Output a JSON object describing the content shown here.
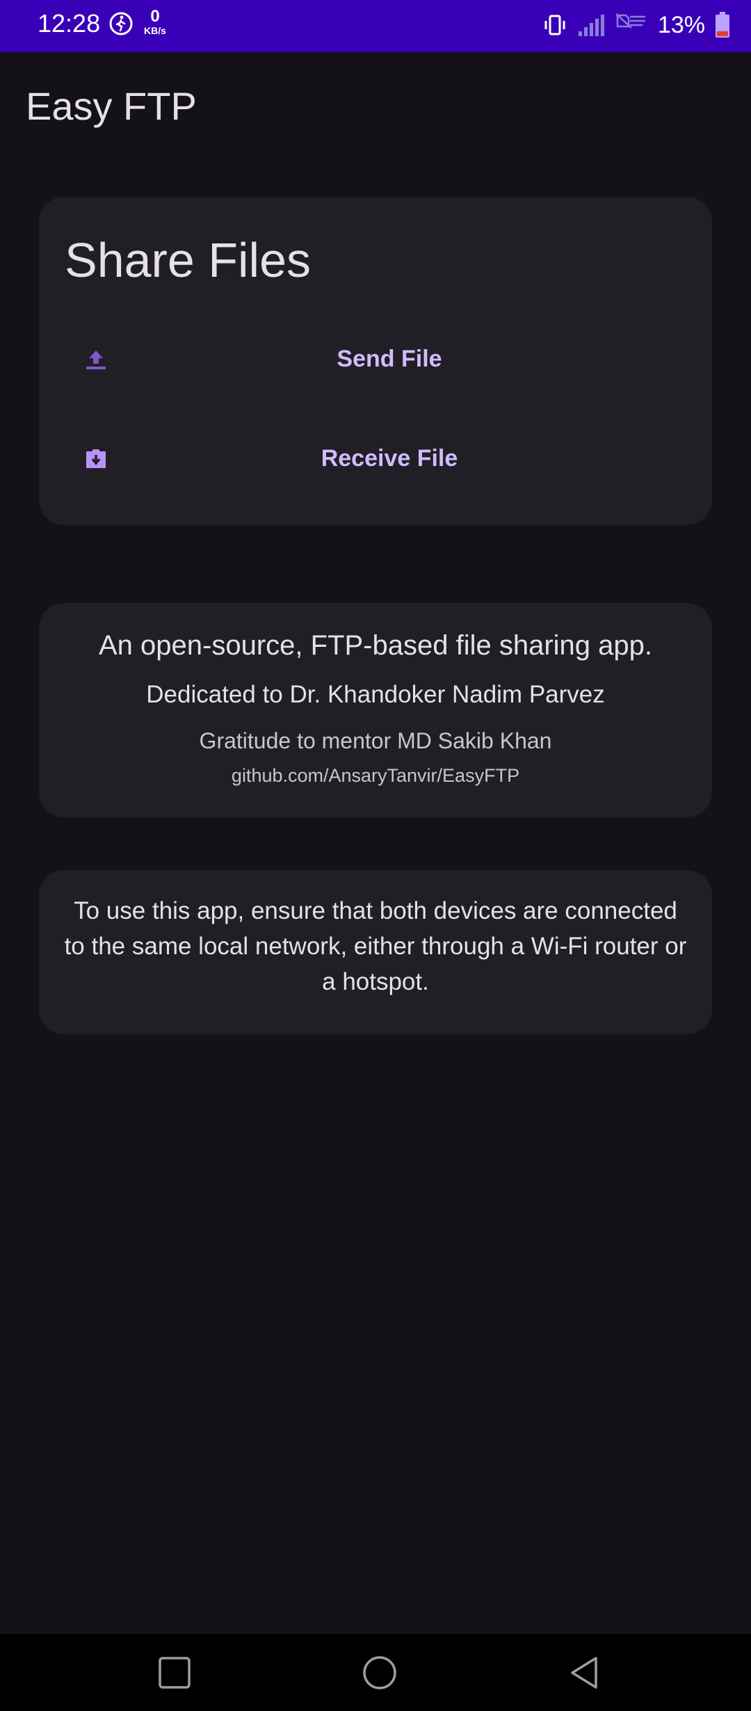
{
  "status_bar": {
    "time": "12:28",
    "net_speed_value": "0",
    "net_speed_unit": "KB/s",
    "battery_percent": "13%"
  },
  "app": {
    "title": "Easy FTP"
  },
  "share_card": {
    "title": "Share Files",
    "send_label": "Send File",
    "send_icon": "upload-icon",
    "receive_label": "Receive File",
    "receive_icon": "download-icon"
  },
  "about_card": {
    "description": "An open-source, FTP-based file sharing app.",
    "dedication": "Dedicated to Dr. Khandoker Nadim Parvez",
    "gratitude": "Gratitude to mentor MD Sakib Khan",
    "repo_link": "github.com/AnsaryTanvir/EasyFTP"
  },
  "info_card": {
    "text": "To use this app, ensure that both devices are connected to the same local network, either through a Wi-Fi router or a hotspot."
  },
  "colors": {
    "status_bar": "#3a00b8",
    "background": "#141218",
    "card": "#211f26",
    "accent": "#d0bcff",
    "battery_low": "#e53935"
  }
}
